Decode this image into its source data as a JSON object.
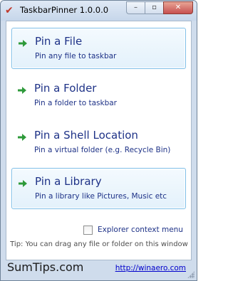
{
  "window": {
    "title": "TaskbarPinner 1.0.0.0",
    "minimize_glyph": "–",
    "maximize_glyph": "▫",
    "close_glyph": "✕",
    "app_icon": "pin-icon"
  },
  "buttons": [
    {
      "title": "Pin a File",
      "subtitle": "Pin any file to taskbar",
      "highlighted": true
    },
    {
      "title": "Pin a Folder",
      "subtitle": "Pin a folder to taskbar",
      "highlighted": false
    },
    {
      "title": "Pin a Shell Location",
      "subtitle": "Pin a virtual folder (e.g. Recycle Bin)",
      "highlighted": false
    },
    {
      "title": "Pin a Library",
      "subtitle": "Pin a library like Pictures, Music etc",
      "highlighted": true
    }
  ],
  "options": {
    "explorer_menu_label": "Explorer context menu",
    "explorer_menu_checked": false
  },
  "tip": "Tip: You can drag any file or folder on this window",
  "footer": {
    "watermark": "SumTips.com",
    "link": "http://winaero.com"
  },
  "colors": {
    "accent_text": "#1e3287",
    "arrow_green": "#2e9a3a",
    "highlight_border": "#7fbfe8"
  }
}
